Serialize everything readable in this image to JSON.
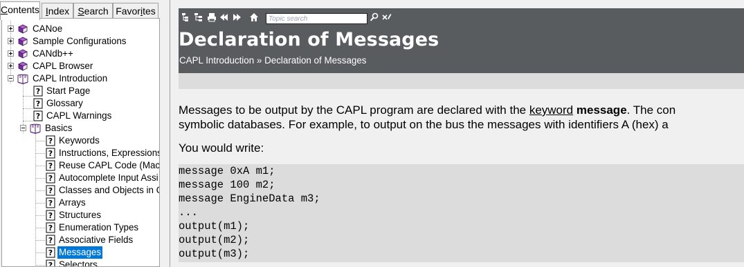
{
  "tabs": [
    {
      "accel": "C",
      "rest": "ontents",
      "active": true
    },
    {
      "accel": "I",
      "rest": "ndex",
      "active": false
    },
    {
      "accel": "S",
      "rest": "earch",
      "active": false
    },
    {
      "pre": "Favor",
      "accel": "i",
      "rest": "tes",
      "active": false
    }
  ],
  "tree": {
    "root": [
      {
        "label": "CANoe",
        "icon": "closed-book-icon"
      },
      {
        "label": "Sample Configurations",
        "icon": "closed-book-icon"
      },
      {
        "label": "CANdb++",
        "icon": "closed-book-icon"
      },
      {
        "label": "CAPL Browser",
        "icon": "closed-book-icon"
      },
      {
        "label": "CAPL Introduction",
        "icon": "open-book-icon"
      }
    ],
    "capl_intro_children": [
      {
        "label": "Start Page",
        "icon": "help-page-icon"
      },
      {
        "label": "Glossary",
        "icon": "help-page-icon"
      },
      {
        "label": "CAPL Warnings",
        "icon": "help-page-icon"
      },
      {
        "label": "Basics",
        "icon": "open-book-icon"
      }
    ],
    "basics_children": [
      {
        "label": "Keywords"
      },
      {
        "label": "Instructions, Expressions"
      },
      {
        "label": "Reuse CAPL Code (Mac"
      },
      {
        "label": "Autocomplete Input Assi"
      },
      {
        "label": "Classes and Objects in C"
      },
      {
        "label": "Arrays"
      },
      {
        "label": "Structures"
      },
      {
        "label": "Enumeration Types"
      },
      {
        "label": "Associative Fields"
      },
      {
        "label": "Messages"
      },
      {
        "label": "Selectors"
      }
    ],
    "selected": "Messages"
  },
  "toolbar": {
    "icons": [
      "tree-collapse-icon",
      "tree-expand-icon",
      "print-icon",
      "back-icon",
      "forward-icon",
      "home-icon",
      "search-go-icon",
      "clear-highlights-icon"
    ],
    "search_placeholder": "Topic search"
  },
  "page": {
    "title": "Declaration of Messages",
    "breadcrumb": [
      "CAPL Introduction",
      "Declaration of Messages"
    ],
    "breadcrumb_separator": "»",
    "paragraph1_a": "Messages to be output by the CAPL program are declared with the ",
    "paragraph1_link": "keyword",
    "paragraph1_space": " ",
    "paragraph1_bold": "message",
    "paragraph1_b": ". The con",
    "paragraph2": "symbolic databases. For example, to output on the bus the messages with identifiers A (hex) a",
    "paragraph3": "You would write:",
    "code": [
      "message 0xA m1;",
      "message 100 m2;",
      "message EngineData m3;",
      "...",
      "output(m1);",
      "output(m2);",
      "output(m3);"
    ]
  },
  "colors": {
    "header_bg": "#595c5e",
    "band_bg": "#dcdcdc",
    "selection": "#0078d7",
    "book": "#7b2f9e"
  }
}
